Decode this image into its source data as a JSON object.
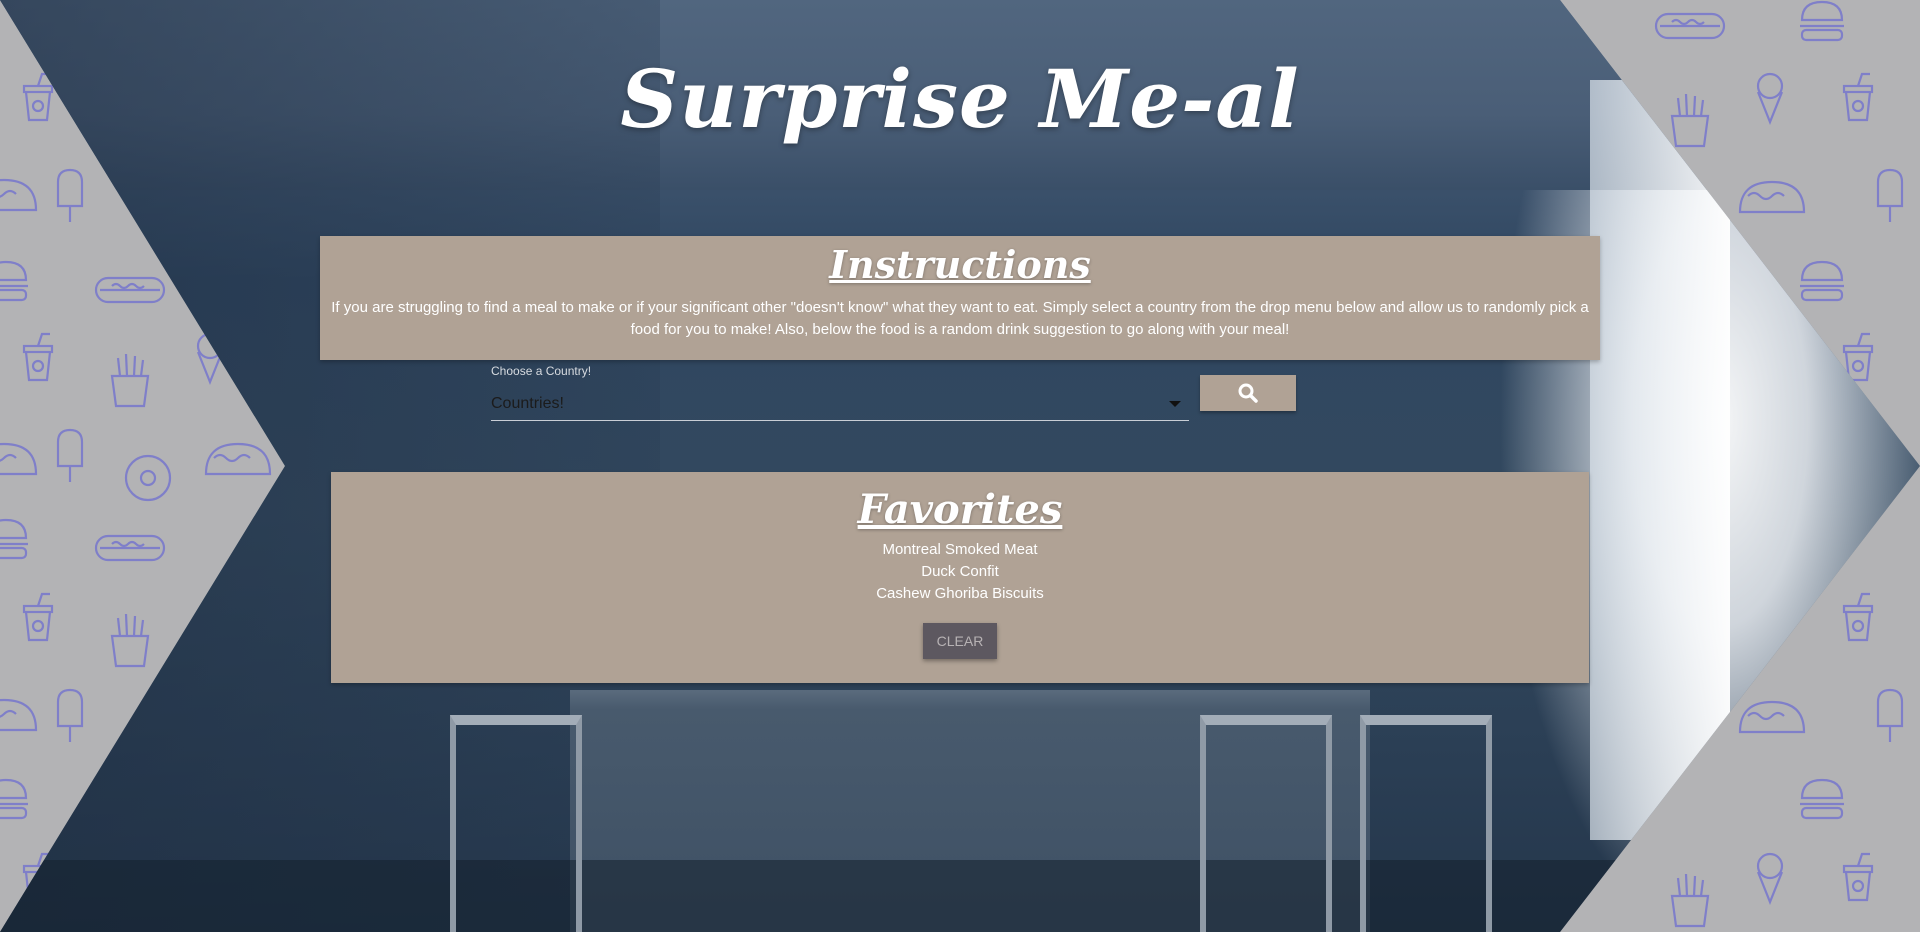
{
  "header": {
    "title": "Surprise Me-al"
  },
  "instructions": {
    "heading": "Instructions",
    "text": "If you are struggling to find a meal to make or if your significant other \"doesn't know\" what they want to eat. Simply select a country from the drop menu below and allow us to randomly pick a food for you to make! Also, below the food is a random drink suggestion to go along with your meal!"
  },
  "search": {
    "label": "Choose a Country!",
    "selected": "Countries!",
    "button_icon": "search-icon"
  },
  "favorites": {
    "heading": "Favorites",
    "items": [
      "Montreal Smoked Meat",
      "Duck Confit",
      "Cashew Ghoriba Biscuits"
    ],
    "clear_label": "CLEAR"
  },
  "colors": {
    "panel": "#b0a295",
    "clear_button": "#5d5860",
    "pattern_icons": "#7f7fc9",
    "pattern_bg": "#b3b3b5"
  },
  "background": {
    "pattern_icons": [
      "soda-cup-icon",
      "hotdog-icon",
      "burger-icon",
      "taco-icon",
      "ice-cream-cone-icon",
      "popsicle-icon",
      "fries-icon",
      "donut-icon"
    ]
  }
}
